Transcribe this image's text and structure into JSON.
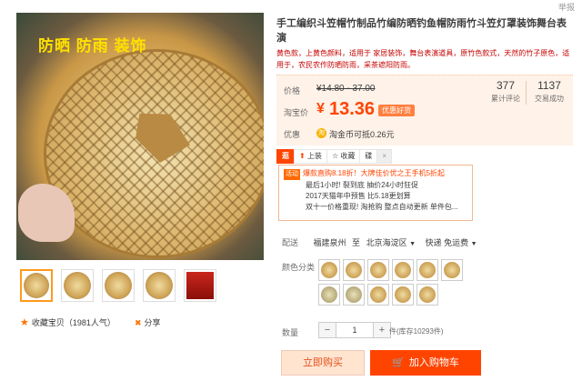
{
  "report_link": "举报",
  "main_image": {
    "banner_text": "防晒 防雨 装饰"
  },
  "product": {
    "title": "手工编织斗笠帽竹制品竹编防晒钓鱼帽防雨竹斗笠灯罩装饰舞台表演",
    "description": "黄色款，上黄色颜料，适用于 家居装饰，舞台表演道具，原竹色款式，天然的竹子原色，适用于，农民农作防晒防雨，采茶遮阳防雨。"
  },
  "price": {
    "label": "价格",
    "original": "¥14.80 - 37.00",
    "taobao_label": "淘宝价",
    "currency": "¥",
    "current": "13.36",
    "badge": "优惠好货",
    "reviews_count": "377",
    "reviews_label": "累计评论",
    "sales_count": "1137",
    "sales_label": "交易成功",
    "discount_label": "优惠",
    "coin_text": "淘金币可抵0.26元"
  },
  "promo_bar": [
    "逛",
    "上装",
    "收藏",
    "碟",
    "×"
  ],
  "promo": {
    "tag": "活动",
    "lines": [
      "爆款直购8.18折！大牌佳价优之王手机5折起",
      "最后1小时! 裂到底 抽价24小时狂促",
      "2017天猫年中预售 比5.18更划算",
      "双十一价格重现! 淘抢购 整点自动更新 单件包..."
    ]
  },
  "delivery": {
    "label": "配送",
    "from": "福建泉州",
    "to_word": "至",
    "to": "北京海淀区",
    "shipping": "快递 免运费"
  },
  "color_label": "颜色分类",
  "quantity": {
    "label": "数量",
    "minus": "−",
    "value": "1",
    "plus": "+",
    "stock": "件(库存10293件)"
  },
  "buttons": {
    "buy_now": "立即购买",
    "add_cart": "加入购物车"
  },
  "collect": {
    "text": "收藏宝贝（1981人气）"
  },
  "share": {
    "text": "分享"
  },
  "colors": {
    "accent": "#ff4400",
    "price_bg": "#fff2e8",
    "buy_now_bg": "#ffe4d0"
  }
}
